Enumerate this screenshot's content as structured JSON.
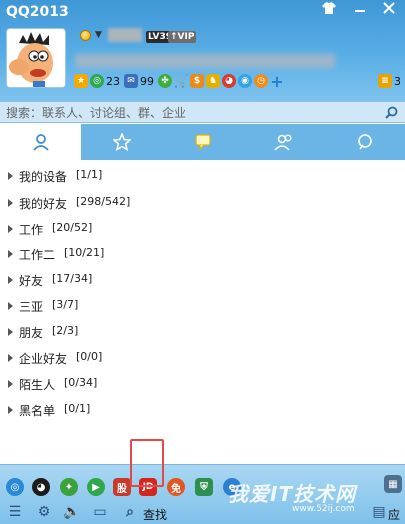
{
  "window": {
    "title": "QQ2013",
    "controls": [
      "shirt-icon",
      "minimize-icon",
      "close-icon"
    ]
  },
  "profile": {
    "level_badge": "LV39",
    "vip_badge": "VIP"
  },
  "apps": {
    "qzone_count": "23",
    "mail_count": "99",
    "mail_right_count": "3"
  },
  "search": {
    "placeholder": "搜索：联系人、讨论组、群、企业"
  },
  "tabs": [
    {
      "name": "contacts",
      "icon": "person-icon",
      "active": true
    },
    {
      "name": "favorites",
      "icon": "star-icon",
      "active": false
    },
    {
      "name": "groups",
      "icon": "chat-icon",
      "active": false
    },
    {
      "name": "discussions",
      "icon": "people-icon",
      "active": false
    },
    {
      "name": "recent",
      "icon": "qzone-icon",
      "active": false
    }
  ],
  "groups": [
    {
      "name": "我的设备",
      "count": "[1/1]"
    },
    {
      "name": "我的好友",
      "count": "[298/542]"
    },
    {
      "name": "工作",
      "count": "[20/52]"
    },
    {
      "name": "工作二",
      "count": "[10/21]"
    },
    {
      "name": "好友",
      "count": "[17/34]"
    },
    {
      "name": "三亚",
      "count": "[3/7]"
    },
    {
      "name": "朋友",
      "count": "[2/3]"
    },
    {
      "name": "企业好友",
      "count": "[0/0]"
    },
    {
      "name": "陌生人",
      "count": "[0/34]"
    },
    {
      "name": "黑名单",
      "count": "[0/1]"
    }
  ],
  "bottombar": {
    "stock_label": "股",
    "jd_label": "JD",
    "free_label": "免",
    "find_label": "查找",
    "app_label": "应用",
    "watermark": "我爱IT技术网",
    "watermark_url": "www.52ij.com"
  }
}
